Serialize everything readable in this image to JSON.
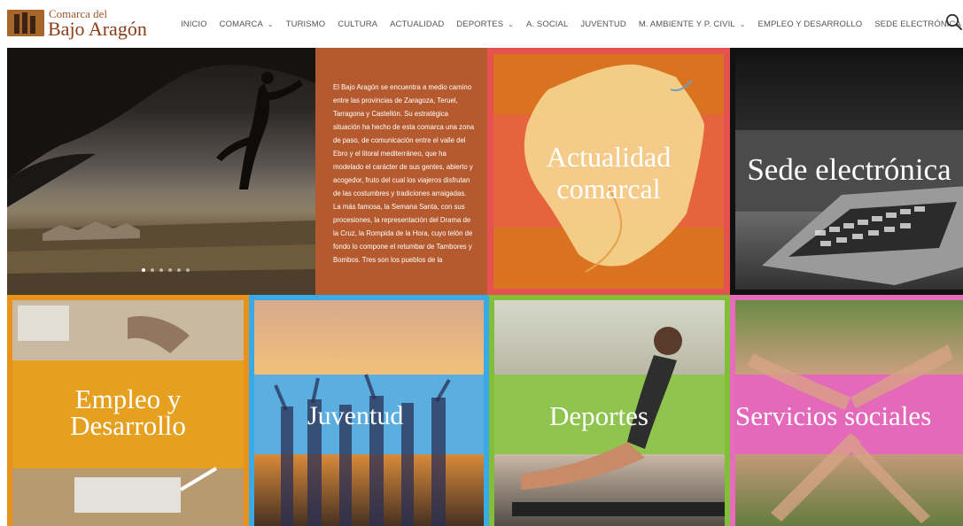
{
  "header": {
    "logo": {
      "line1": "Comarca del",
      "line2": "Bajo Aragón"
    },
    "nav": [
      {
        "label": "INICIO",
        "dropdown": false
      },
      {
        "label": "COMARCA",
        "dropdown": true
      },
      {
        "label": "TURISMO",
        "dropdown": false
      },
      {
        "label": "CULTURA",
        "dropdown": false
      },
      {
        "label": "ACTUALIDAD",
        "dropdown": false
      },
      {
        "label": "DEPORTES",
        "dropdown": true
      },
      {
        "label": "A. SOCIAL",
        "dropdown": false
      },
      {
        "label": "JUVENTUD",
        "dropdown": false
      },
      {
        "label": "M. AMBIENTE Y P. CIVIL",
        "dropdown": true
      },
      {
        "label": "EMPLEO Y DESARROLLO",
        "dropdown": false
      },
      {
        "label": "SEDE ELECTRÓNICA",
        "dropdown": false
      }
    ],
    "search_icon": "search-icon"
  },
  "slider": {
    "slide_count": 6,
    "active_slide": 1
  },
  "intro_text": "El Bajo Aragón se encuentra a medio camino entre las provincias de Zaragoza, Teruel, Tarragona y Castellón. Su estratégica situación ha hecho de esta comarca una zona de paso, de comunicación entre el valle del Ebro y el litoral mediterráneo, que ha modelado el carácter de sus gentes, abierto y acogedor, fruto del cual los viajeros disfrutan de las costumbres y tradiciones arraigadas. La más famosa, la Semana Santa, con sus procesiones, la representación del Drama de la Cruz, la Rompida de la Hora, cuyo telón de fondo lo compone el retumbar de Tambores y Bombos. Tres son los pueblos de la",
  "tiles": {
    "actualidad": {
      "line1": "Actualidad",
      "line2": "comarcal",
      "color": "#e6524f"
    },
    "sede": {
      "label": "Sede electrónica",
      "color": "#111111"
    },
    "empleo": {
      "line1": "Empleo y",
      "line2": "Desarrollo",
      "color": "#e8921c"
    },
    "juventud": {
      "label": "Juventud",
      "color": "#3aaae6"
    },
    "deportes": {
      "label": "Deportes",
      "color": "#83be3a"
    },
    "servicios": {
      "label": "Servicios sociales",
      "color": "#e86cbc"
    }
  },
  "colors": {
    "brand": "#8a3d17",
    "text_panel": "#b55a2e"
  }
}
